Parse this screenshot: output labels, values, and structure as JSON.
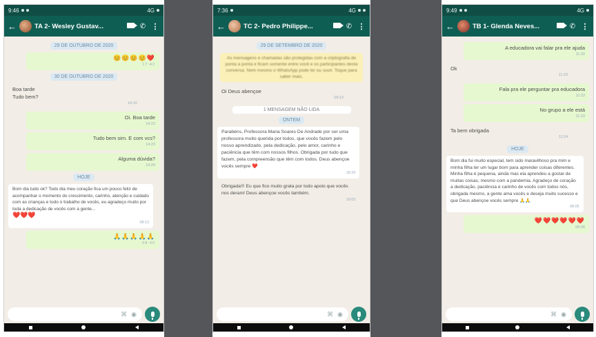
{
  "chats": [
    {
      "status_time": "9:46",
      "status_right": "4G",
      "title": "TA 2- Wesley Gustav...",
      "date_pill_1": "29 DE OUTUBRO DE 2020",
      "msg_1": "😊😊😊😊❤️",
      "msg_1_time": "17:42",
      "date_pill_2": "30 DE OUTUBRO DE 2020",
      "msg_2": "Boa tarde\nTudo bem?",
      "msg_2_time": "14:10",
      "msg_3": "Oi. Boa tarde",
      "msg_3_time": "14:23",
      "msg_4": "Tudo bem sim. E com vcs?",
      "msg_4_time": "14:23",
      "msg_5": "Alguma dúvida?",
      "msg_5_time": "14:24",
      "date_pill_3": "HOJE",
      "msg_6": "Bom dia tudo ok? Todo dia meu coração fica um pouco feliz de acompanhar o momento do crescimento, carinho, atenção e cuidado com as crianças e todo o trabalho de vocês, eu agradeço muito por toda a dedicação de vocês com a gente...",
      "msg_6_emojis": "❤️❤️❤️",
      "msg_6_time": "08:12",
      "msg_7": "🙏🙏🙏🙏🙏",
      "msg_7_time": "08:40"
    },
    {
      "status_time": "7:36",
      "status_right": "4G",
      "title": "TC 2- Pedro Philippe...",
      "date_pill_1": "29 DE SETEMBRO DE 2020",
      "notice": "As mensagens e chamadas são protegidas com a criptografia de ponta a ponta e ficam somente entre você e os participantes desta conversa. Nem mesmo o WhatsApp pode ler ou ouvir. Toque para saber mais.",
      "msg_1": "Oi Deus abençoe",
      "msg_1_time": "09:12",
      "msg_2": "1 MENSAGEM NÃO LIDA",
      "date_pill_2": "ONTEM",
      "msg_3": "Parabéns, Professora Maria Soares De Andrade por ser uma professora muito querida por todos, que vocês fazem pelo nosso aprendizado, pela dedicação, pelo amor, carinho e paciência que têm com nossos filhos. Obrigada por tudo que fazem, pela compreensão que têm com todos. Deus abençoe vocês sempre ❤️",
      "msg_3_time": "18:20",
      "msg_4": "Obrigada!!! Eu que fico muito grata por todo apoio que vocês nos deram! Deus abençoe vocês também.",
      "msg_4_time": "19:02"
    },
    {
      "status_time": "9:49",
      "status_right": "4G",
      "title": "TB 1- Glenda Neves...",
      "msg_1": "A educadora vai falar pra ele ajuda",
      "msg_1_time": "11:20",
      "msg_2": "Ok",
      "msg_2_time": "11:22",
      "msg_3": "Fala pra ele perguntar pra educadora",
      "msg_3_time": "11:23",
      "msg_4": "No grupo a ele está",
      "msg_4_time": "11:23",
      "msg_5": "Ta bem obrigada",
      "msg_5_time": "11:24",
      "date_pill_1": "HOJE",
      "msg_6": "Bom dia fui muito especial, tem sido maravilhoso pra mim e minha filha ter um lugar bom para aprender coisas diferentes. Minha filha é pequena, ainda mas ela aprendeu a gostar de muitas coisas, mesmo com a pandemia. Agradeço de coração a dedicação, paciência e carinho de vocês com todos nós, obrigada mesmo, a gente ama vocês e deseja muito sucesso e que Deus abençoe vocês sempre 🙏🙏",
      "msg_6_time": "08:05",
      "msg_7": "❤️❤️❤️❤️❤️❤️",
      "msg_7_time": "08:06"
    }
  ]
}
